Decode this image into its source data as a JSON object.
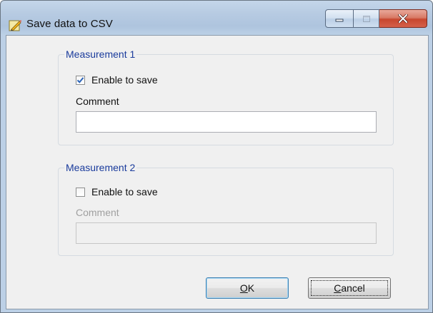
{
  "window": {
    "title": "Save data to CSV",
    "icon": "csv-pencil-icon"
  },
  "caption_buttons": {
    "minimize_icon": "minimize-icon",
    "maximize_icon": "maximize-icon",
    "close_icon": "close-icon"
  },
  "measurement1": {
    "legend": "Measurement 1",
    "enable_label": "Enable to save",
    "enable_checked": true,
    "comment_label": "Comment",
    "comment_value": "",
    "enabled": true
  },
  "measurement2": {
    "legend": "Measurement 2",
    "enable_label": "Enable to save",
    "enable_checked": false,
    "comment_label": "Comment",
    "comment_value": "",
    "enabled": false
  },
  "buttons": {
    "ok": {
      "mnemonic": "O",
      "rest": "K"
    },
    "cancel": {
      "mnemonic": "C",
      "rest": "ancel"
    }
  },
  "colors": {
    "legend_text": "#1a3b9c",
    "checkmark": "#2a63b8",
    "close_button": "#c7472f"
  }
}
